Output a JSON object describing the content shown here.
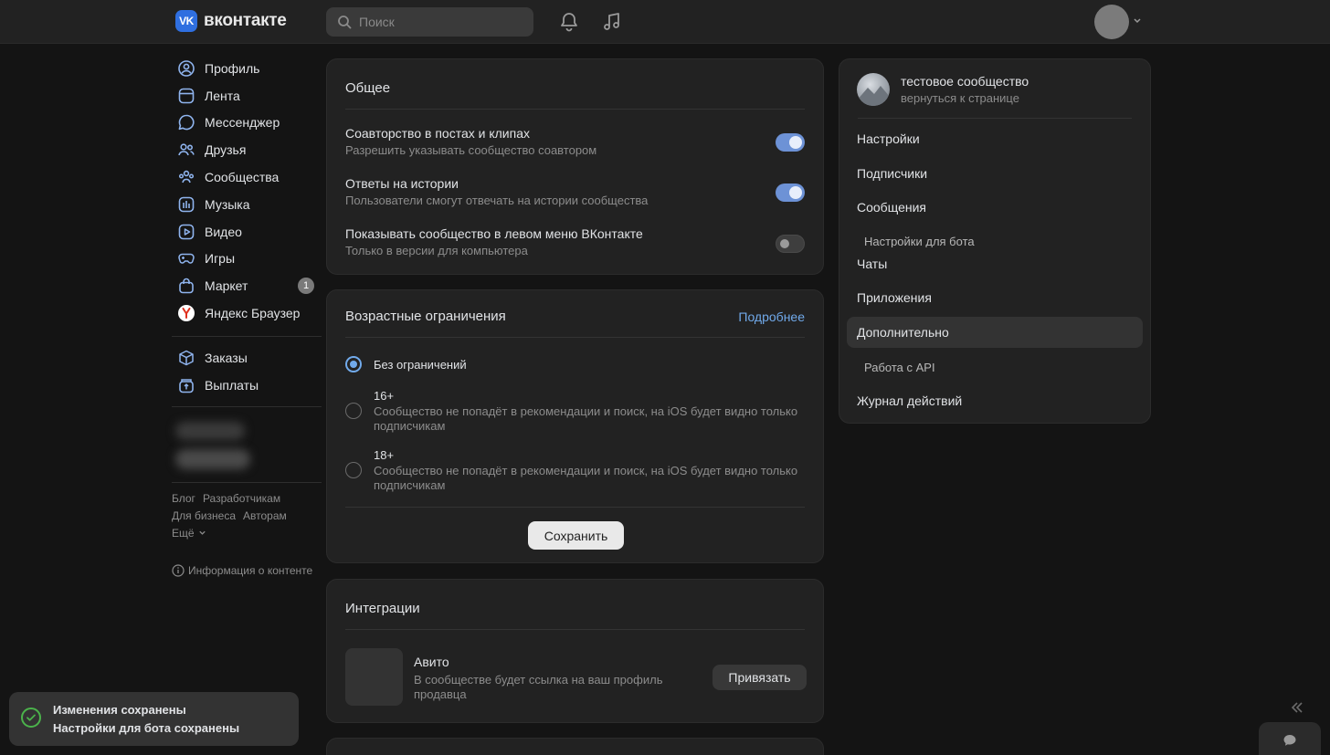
{
  "header": {
    "logo_mark": "VK",
    "logo_text": "вконтакте",
    "search_placeholder": "Поиск"
  },
  "leftnav": {
    "items": [
      {
        "label": "Профиль",
        "icon": "profile-icon"
      },
      {
        "label": "Лента",
        "icon": "feed-icon"
      },
      {
        "label": "Мессенджер",
        "icon": "messenger-icon"
      },
      {
        "label": "Друзья",
        "icon": "friends-icon"
      },
      {
        "label": "Сообщества",
        "icon": "communities-icon"
      },
      {
        "label": "Музыка",
        "icon": "music-icon"
      },
      {
        "label": "Видео",
        "icon": "video-icon"
      },
      {
        "label": "Игры",
        "icon": "games-icon"
      },
      {
        "label": "Маркет",
        "icon": "market-icon",
        "badge": "1"
      },
      {
        "label": "Яндекс Браузер",
        "icon": "yandex-icon"
      }
    ],
    "items2": [
      {
        "label": "Заказы",
        "icon": "orders-icon"
      },
      {
        "label": "Выплаты",
        "icon": "payouts-icon"
      }
    ],
    "footer": {
      "blog": "Блог",
      "developers": "Разработчикам",
      "business": "Для бизнеса",
      "authors": "Авторам",
      "more": "Ещё"
    },
    "info": "Информация о контенте"
  },
  "general": {
    "title": "Общее",
    "settings": [
      {
        "title": "Соавторство в постах и клипах",
        "subtitle": "Разрешить указывать сообщество соавтором",
        "enabled": true
      },
      {
        "title": "Ответы на истории",
        "subtitle": "Пользователи смогут отвечать на истории сообщества",
        "enabled": true
      },
      {
        "title": "Показывать сообщество в левом меню ВКонтакте",
        "subtitle": "Только в версии для компьютера",
        "enabled": false
      }
    ]
  },
  "age": {
    "title": "Возрастные ограничения",
    "more_link": "Подробнее",
    "options": [
      {
        "title": "Без ограничений",
        "desc": "",
        "selected": true
      },
      {
        "title": "16+",
        "desc": "Сообщество не попадёт в рекомендации и поиск, на iOS будет видно только подписчикам",
        "selected": false
      },
      {
        "title": "18+",
        "desc": "Сообщество не попадёт в рекомендации и поиск, на iOS будет видно только подписчикам",
        "selected": false
      }
    ],
    "save_label": "Сохранить"
  },
  "integrations": {
    "title": "Интеграции",
    "avito_title": "Авито",
    "avito_desc": "В сообществе будет ссылка на ваш профиль продавца",
    "bind_label": "Привязать"
  },
  "community": {
    "name": "тестовое сообщество",
    "back": "вернуться к странице",
    "menu": [
      {
        "label": "Настройки",
        "sub": false,
        "active": false
      },
      {
        "label": "Подписчики",
        "sub": false,
        "active": false
      },
      {
        "label": "Сообщения",
        "sub": false,
        "active": false
      },
      {
        "label": "Настройки для бота",
        "sub": true,
        "active": false
      },
      {
        "label": "Чаты",
        "sub": false,
        "active": false
      },
      {
        "label": "Приложения",
        "sub": false,
        "active": false
      },
      {
        "label": "Дополнительно",
        "sub": false,
        "active": true
      },
      {
        "label": "Работа с API",
        "sub": true,
        "active": false
      },
      {
        "label": "Журнал действий",
        "sub": false,
        "active": false
      }
    ]
  },
  "toast": {
    "title": "Изменения сохранены",
    "message": "Настройки для бота сохранены"
  },
  "colors": {
    "accent": "#71aaeb",
    "toggle_on": "#6d92d6",
    "success": "#4bb34b",
    "background": "#141414",
    "card": "#222222"
  }
}
